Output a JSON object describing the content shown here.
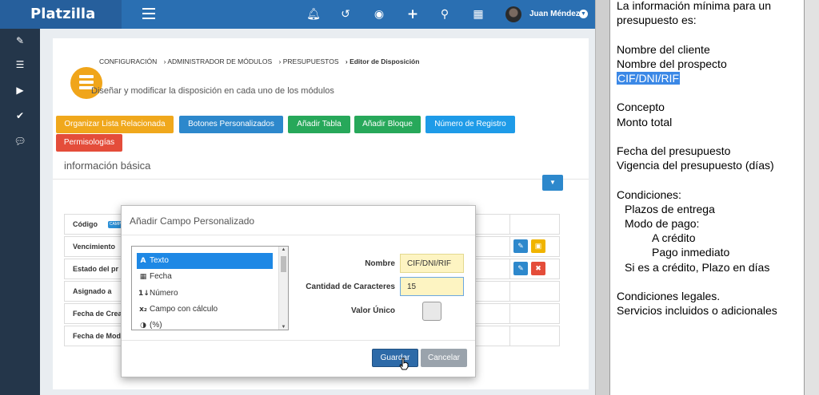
{
  "app": {
    "brand": "Platzilla",
    "user_name": "Juan Méndez",
    "topbar_icons": [
      "bell-icon",
      "history-icon",
      "eye-icon",
      "plus-icon",
      "search-icon",
      "grid-icon"
    ],
    "sidebar_icons": [
      "edit-icon",
      "list-icon",
      "play-icon",
      "check-icon",
      "chat-icon"
    ]
  },
  "breadcrumb": {
    "items": [
      "CONFIGURACIÓN",
      "› ADMINISTRADOR DE MÓDULOS",
      "› PRESUPUESTOS",
      "› Editor de Disposición"
    ]
  },
  "page": {
    "subtitle": "Diseñar y modificar la disposición en cada uno de los módulos"
  },
  "toolbar": {
    "buttons": [
      {
        "label": "Organizar Lista Relacionada",
        "color": "#f0a81c"
      },
      {
        "label": "Botones Personalizados",
        "color": "#2d88cc"
      },
      {
        "label": "Añadir Tabla",
        "color": "#27a85a"
      },
      {
        "label": "Añadir Bloque",
        "color": "#27a85a"
      },
      {
        "label": "Número de Registro",
        "color": "#1e9be8"
      },
      {
        "label": "Permisologías",
        "color": "#e44d3a"
      }
    ]
  },
  "section": {
    "title": "información básica",
    "rows": [
      "Código",
      "Vencimiento",
      "Estado del pr",
      "Asignado a",
      "Fecha de Crea",
      "Fecha de Mod"
    ],
    "badge": "CAMPO"
  },
  "modal": {
    "title": "Añadir Campo Personalizado",
    "field_types": [
      {
        "icon": "text-icon",
        "glyph": "A",
        "label": "Texto"
      },
      {
        "icon": "calendar-icon",
        "glyph": "▦",
        "label": "Fecha"
      },
      {
        "icon": "number-icon",
        "glyph": "1↓",
        "label": "Número"
      },
      {
        "icon": "formula-icon",
        "glyph": "x₂",
        "label": "Campo con cálculo"
      },
      {
        "icon": "percent-icon",
        "glyph": "◑",
        "label": "(%)"
      }
    ],
    "selected_index": 0,
    "name_label": "Nombre",
    "name_value": "CIF/DNI/RIF",
    "chars_label": "Cantidad de Caracteres",
    "chars_value": "15",
    "unique_label": "Valor Único",
    "save_label": "Guardar",
    "cancel_label": "Cancelar"
  },
  "notes": {
    "lines": [
      {
        "text": "La información mínima para un",
        "indent": 0
      },
      {
        "text": "presupuesto es:",
        "indent": 0
      },
      {
        "text": "",
        "indent": 0
      },
      {
        "text": "Nombre del cliente",
        "indent": 0
      },
      {
        "text": "Nombre del prospecto",
        "indent": 0
      },
      {
        "text": "CIF/DNI/RIF",
        "indent": 0,
        "highlight": true
      },
      {
        "text": "",
        "indent": 0
      },
      {
        "text": "Concepto",
        "indent": 0
      },
      {
        "text": "Monto total",
        "indent": 0
      },
      {
        "text": "",
        "indent": 0
      },
      {
        "text": "Fecha del presupuesto",
        "indent": 0
      },
      {
        "text": "Vigencia del presupuesto (días)",
        "indent": 0
      },
      {
        "text": "",
        "indent": 0
      },
      {
        "text": "Condiciones:",
        "indent": 0
      },
      {
        "text": "Plazos de entrega",
        "indent": 1
      },
      {
        "text": "Modo de pago:",
        "indent": 1
      },
      {
        "text": "A crédito",
        "indent": 3
      },
      {
        "text": "Pago inmediato",
        "indent": 3
      },
      {
        "text": "Si es a crédito, Plazo en días",
        "indent": 1
      },
      {
        "text": "",
        "indent": 0
      },
      {
        "text": "Condiciones legales.",
        "indent": 0
      },
      {
        "text": "Servicios incluidos o adicionales",
        "indent": 0
      }
    ]
  }
}
